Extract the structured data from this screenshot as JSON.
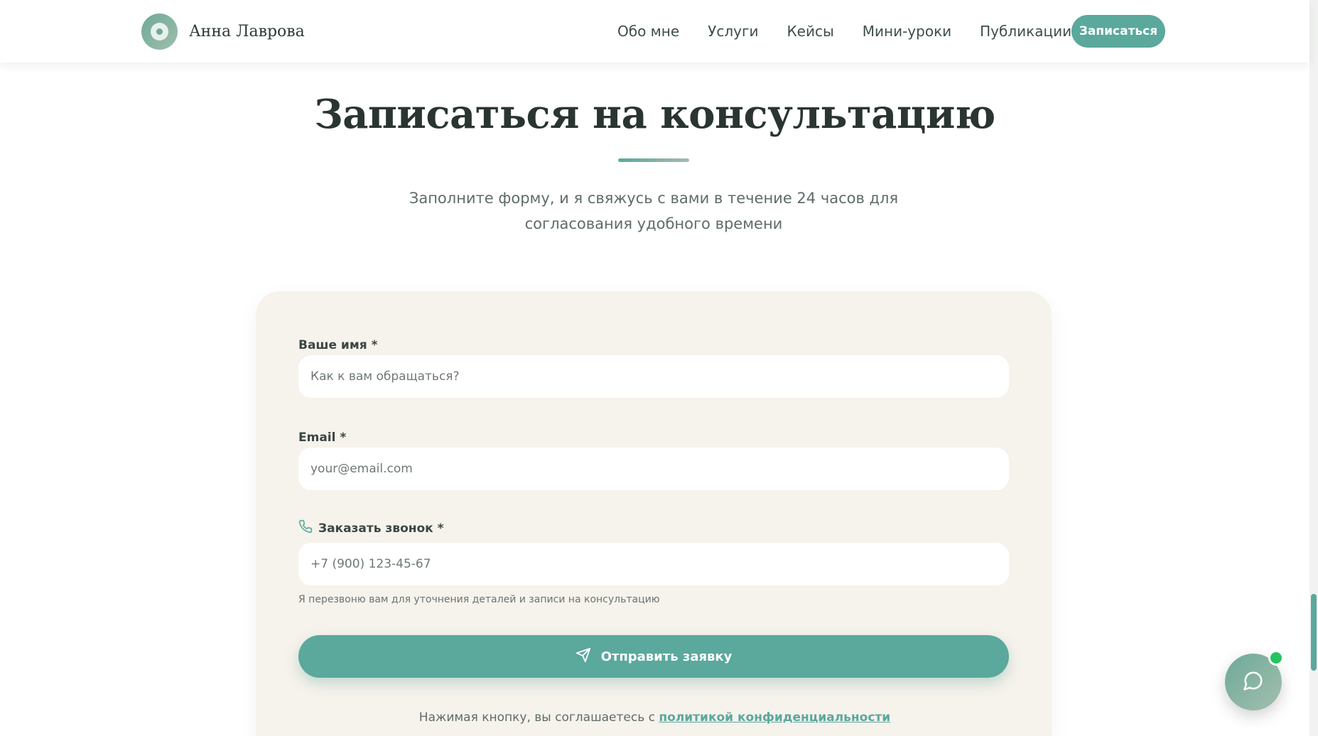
{
  "header": {
    "brand_name": "Анна Лаврова",
    "nav": [
      {
        "label": "Обо мне"
      },
      {
        "label": "Услуги"
      },
      {
        "label": "Кейсы"
      },
      {
        "label": "Мини-уроки"
      },
      {
        "label": "Публикации"
      }
    ],
    "cta_label": "Записаться"
  },
  "hero": {
    "title": "Записаться на консультацию",
    "subtitle": "Заполните форму, и я свяжусь с вами в течение 24 часов для согласования удобного времени"
  },
  "form": {
    "name": {
      "label": "Ваше имя *",
      "placeholder": "Как к вам обращаться?",
      "value": ""
    },
    "email": {
      "label": "Email *",
      "placeholder": "your@email.com",
      "value": ""
    },
    "phone": {
      "label": "Заказать звонок *",
      "placeholder": "+7 (900) 123-45-67",
      "value": "",
      "hint": "Я перезвоню вам для уточнения деталей и записи на консультацию"
    },
    "submit_label": "Отправить заявку",
    "consent_text": "Нажимая кнопку, вы соглашаетесь с ",
    "consent_link": "политикой конфиденциальности"
  },
  "colors": {
    "accent": "#5ba89c",
    "card_background": "#f6f2ec",
    "online_indicator": "#22c55e"
  },
  "icons": {
    "logo": "circle-target-icon",
    "phone": "phone-icon",
    "send": "send-icon",
    "chat": "chat-bubble-icon"
  }
}
